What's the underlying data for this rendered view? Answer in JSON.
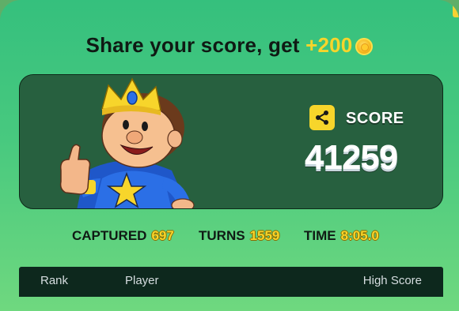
{
  "title": {
    "text": "Share your score, get",
    "bonus": "+200",
    "coin_icon": "gold-coin-icon"
  },
  "score_card": {
    "score_label": "SCORE",
    "score_value": "41259",
    "share_icon": "share-icon",
    "mascot": "king-mascot-thumbs-up"
  },
  "stats": {
    "captured_label": "CAPTURED",
    "captured_value": "697",
    "turns_label": "TURNS",
    "turns_value": "1559",
    "time_label": "TIME",
    "time_value": "8:05.0"
  },
  "leaderboard": {
    "columns": [
      "Rank",
      "Player",
      "High Score"
    ]
  },
  "colors": {
    "accent_yellow": "#f7d52b",
    "card_green": "#27603f",
    "header_dark": "#0d281d"
  }
}
